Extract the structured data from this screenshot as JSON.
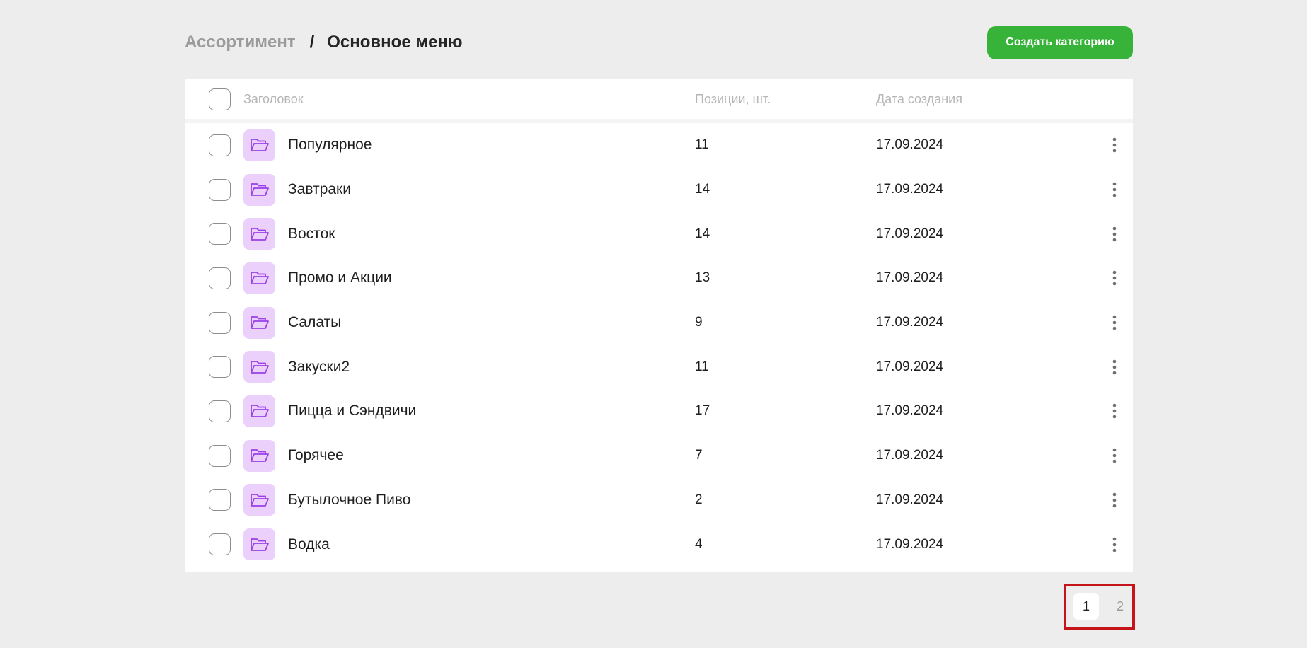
{
  "breadcrumb": {
    "parent": "Ассортимент",
    "separator": "/",
    "current": "Основное меню"
  },
  "actions": {
    "create_label": "Создать категорию"
  },
  "table": {
    "headers": {
      "title": "Заголовок",
      "count": "Позиции, шт.",
      "date": "Дата создания"
    },
    "rows": [
      {
        "title": "Популярное",
        "count": "11",
        "date": "17.09.2024"
      },
      {
        "title": "Завтраки",
        "count": "14",
        "date": "17.09.2024"
      },
      {
        "title": "Восток",
        "count": "14",
        "date": "17.09.2024"
      },
      {
        "title": "Промо и Акции",
        "count": "13",
        "date": "17.09.2024"
      },
      {
        "title": "Салаты",
        "count": "9",
        "date": "17.09.2024"
      },
      {
        "title": "Закуски2",
        "count": "11",
        "date": "17.09.2024"
      },
      {
        "title": "Пицца и Сэндвичи",
        "count": "17",
        "date": "17.09.2024"
      },
      {
        "title": "Горячее",
        "count": "7",
        "date": "17.09.2024"
      },
      {
        "title": "Бутылочное Пиво",
        "count": "2",
        "date": "17.09.2024"
      },
      {
        "title": "Водка",
        "count": "4",
        "date": "17.09.2024"
      }
    ]
  },
  "pagination": {
    "pages": [
      "1",
      "2"
    ],
    "current": "1"
  },
  "icons": {
    "row_icon": "folder-icon",
    "row_menu": "more-vertical-icon"
  },
  "colors": {
    "accent_green": "#37b339",
    "folder_bg": "#ead0fb",
    "folder_icon": "#9b3fe8",
    "highlight_frame": "#c5141a"
  }
}
